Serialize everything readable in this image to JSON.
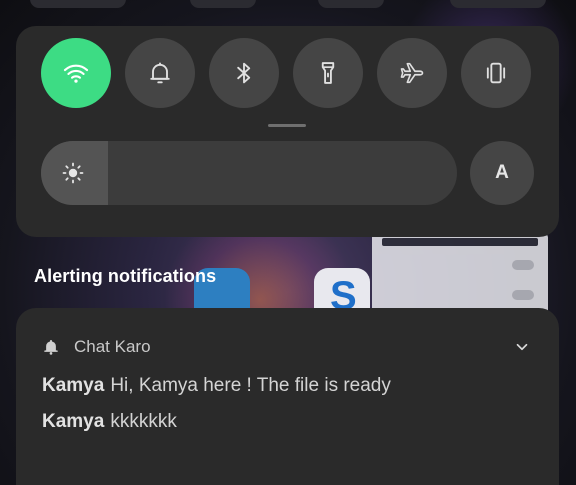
{
  "quick_settings": {
    "tiles": [
      {
        "name": "wifi-tile",
        "icon": "wifi-icon",
        "active": true
      },
      {
        "name": "sound-tile",
        "icon": "bell-icon",
        "active": false
      },
      {
        "name": "bluetooth-tile",
        "icon": "bluetooth-icon",
        "active": false
      },
      {
        "name": "flashlight-tile",
        "icon": "flashlight-icon",
        "active": false
      },
      {
        "name": "airplane-mode-tile",
        "icon": "airplane-icon",
        "active": false
      },
      {
        "name": "vibrate-tile",
        "icon": "vibrate-icon",
        "active": false
      }
    ],
    "brightness_level": 0.16,
    "auto_brightness_label": "A",
    "colors": {
      "active": "#3ddc84",
      "tile": "#454545",
      "panel": "#2a2a2a"
    }
  },
  "notifications": {
    "section_title": "Alerting notifications",
    "cards": [
      {
        "app_icon": "bell-icon",
        "app_name": "Chat Karo",
        "messages": [
          {
            "sender": "Kamya",
            "text": "Hi, Kamya here ! The file is ready"
          },
          {
            "sender": "Kamya",
            "text": "kkkkkkk"
          }
        ]
      }
    ]
  }
}
